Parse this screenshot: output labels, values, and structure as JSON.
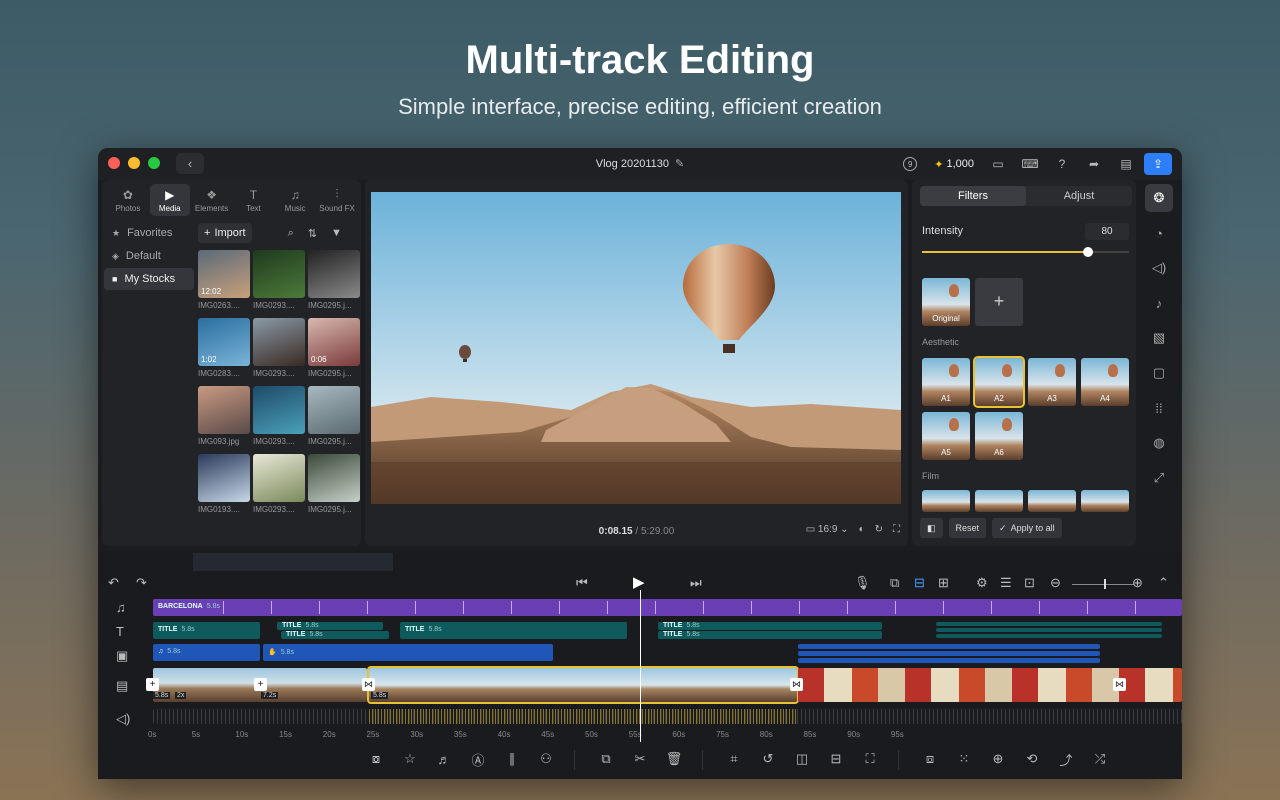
{
  "hero": {
    "title": "Multi-track Editing",
    "subtitle": "Simple interface, precise editing, efficient creation"
  },
  "titlebar": {
    "project": "Vlog 20201130",
    "credits": "1,000",
    "badge": "9"
  },
  "media_tabs": [
    {
      "label": "Photos",
      "icon": "✿"
    },
    {
      "label": "Media",
      "icon": "▶"
    },
    {
      "label": "Elements",
      "icon": "❖"
    },
    {
      "label": "Text",
      "icon": "T"
    },
    {
      "label": "Music",
      "icon": "♫"
    },
    {
      "label": "Sound FX",
      "icon": "⫶"
    }
  ],
  "sidebar": [
    {
      "label": "Favorites",
      "icon": "★"
    },
    {
      "label": "Default",
      "icon": "◈"
    },
    {
      "label": "My Stocks",
      "icon": "■"
    }
  ],
  "media": {
    "import_label": "Import",
    "items": [
      {
        "name": "IMG0263....",
        "duration": "12:02",
        "colors": [
          "#5a6a7a",
          "#c9a07a"
        ]
      },
      {
        "name": "IMG0293....",
        "duration": "",
        "colors": [
          "#1f3a1e",
          "#4c7a3a"
        ]
      },
      {
        "name": "IMG0295.j...",
        "duration": "",
        "colors": [
          "#222",
          "#8a8a8a"
        ]
      },
      {
        "name": "IMG0283....",
        "duration": "1:02",
        "colors": [
          "#2a6ea0",
          "#7ab4d8"
        ]
      },
      {
        "name": "IMG0293....",
        "duration": "",
        "colors": [
          "#8a9aa8",
          "#3a2a22"
        ]
      },
      {
        "name": "IMG0295.j...",
        "duration": "0:06",
        "colors": [
          "#d8b8b0",
          "#7a3a3a"
        ]
      },
      {
        "name": "IMG093.jpg",
        "duration": "",
        "colors": [
          "#c99a80",
          "#5a4a4a"
        ]
      },
      {
        "name": "IMG0293....",
        "duration": "",
        "colors": [
          "#1e4a6a",
          "#4aa0b8"
        ]
      },
      {
        "name": "IMG0295.j...",
        "duration": "",
        "colors": [
          "#a8b8c0",
          "#5a6a70"
        ]
      },
      {
        "name": "IMG0193....",
        "duration": "",
        "colors": [
          "#2a3a5a",
          "#c8d8e8"
        ]
      },
      {
        "name": "IMG0293....",
        "duration": "",
        "colors": [
          "#e8e8d8",
          "#7a8a5a"
        ]
      },
      {
        "name": "IMG0295.j...",
        "duration": "",
        "colors": [
          "#3a4a3a",
          "#c8d0c8"
        ]
      }
    ]
  },
  "preview": {
    "current": "0:08.15",
    "separator": "/",
    "total": "5:29.00",
    "ratio": "16:9"
  },
  "filters": {
    "tab_filters": "Filters",
    "tab_adjust": "Adjust",
    "intensity_label": "Intensity",
    "intensity_value": "80",
    "intensity_level": 0.8,
    "original_label": "Original",
    "aesthetic_label": "Aesthetic",
    "film_label": "Film",
    "aesthetic": [
      "A1",
      "A2",
      "A3",
      "A4",
      "A5",
      "A6"
    ],
    "selected": "A2",
    "reset_label": "Reset",
    "apply_all_label": "Apply to all"
  },
  "timeline": {
    "title_track": {
      "label": "BARCELONA",
      "dur": "5.8s"
    },
    "text_clip_label": "TITLE",
    "text_clip_dur": "5.8s",
    "sticker_dur": "5.8s",
    "video_chips": [
      "5.8s",
      "2x",
      "7.2s",
      "5.8s"
    ],
    "ruler": [
      "0s",
      "5s",
      "10s",
      "15s",
      "20s",
      "25s",
      "30s",
      "35s",
      "40s",
      "45s",
      "50s",
      "55s",
      "60s",
      "75s",
      "80s",
      "85s",
      "90s",
      "95s"
    ],
    "accent": "#e8c232"
  }
}
